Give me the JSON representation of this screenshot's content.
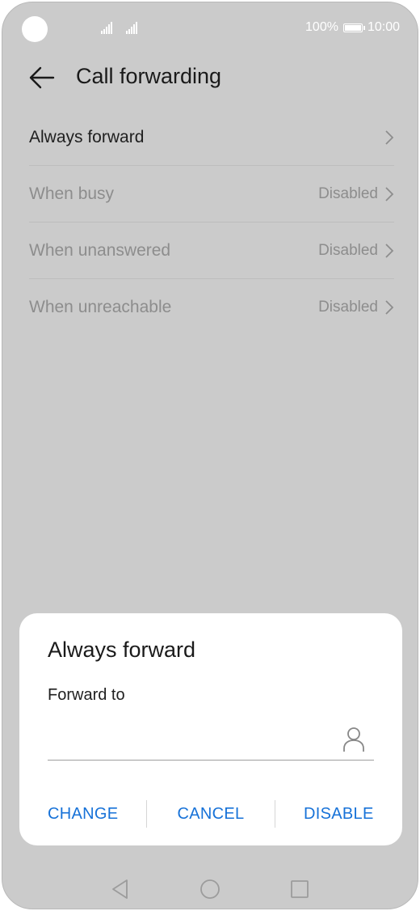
{
  "status_bar": {
    "battery": "100%",
    "time": "10:00",
    "battery_level": 1.0
  },
  "header": {
    "title": "Call forwarding"
  },
  "settings": {
    "items": [
      {
        "label": "Always forward",
        "value": ""
      },
      {
        "label": "When busy",
        "value": "Disabled"
      },
      {
        "label": "When unanswered",
        "value": "Disabled"
      },
      {
        "label": "When unreachable",
        "value": "Disabled"
      }
    ]
  },
  "dialog": {
    "title": "Always forward",
    "subtitle": "Forward to",
    "input_value": "",
    "buttons": {
      "change": "CHANGE",
      "cancel": "CANCEL",
      "disable": "DISABLE"
    }
  },
  "nav_bar": {
    "icons": [
      "back-triangle-icon",
      "home-circle-icon",
      "recents-square-icon"
    ]
  },
  "colors": {
    "accent": "#1772d8",
    "overlay": "#cbcbcb",
    "dialog": "#ffffff"
  }
}
